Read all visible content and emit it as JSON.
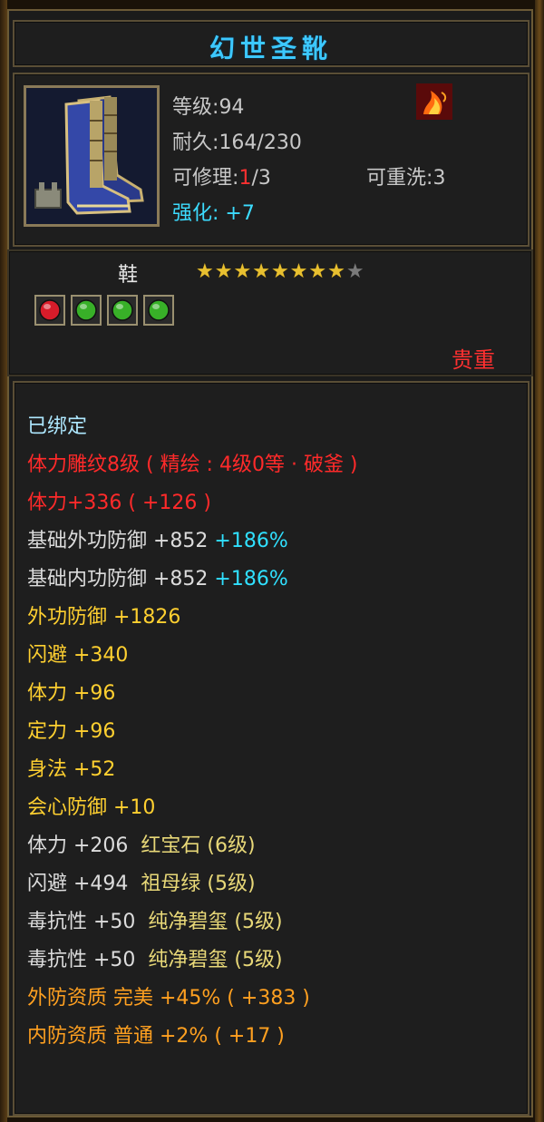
{
  "title": "幻世圣靴",
  "info": {
    "level_label": "等级",
    "level_value": "94",
    "durability_label": "耐久",
    "durability_value": "164/230",
    "repair_label": "可修理",
    "repair_used": "1",
    "repair_total": "/3",
    "rewash_label": "可重洗",
    "rewash_value": "3",
    "enhance_label": "强化:",
    "enhance_value": "+7"
  },
  "item_type": "鞋",
  "stars": {
    "filled": 8,
    "total": 9
  },
  "sockets": [
    {
      "color": "#d81c2a",
      "icon": "red-gem-icon"
    },
    {
      "color": "#38b028",
      "icon": "green-gem-icon"
    },
    {
      "color": "#38b028",
      "icon": "green-gem-icon"
    },
    {
      "color": "#38b028",
      "icon": "green-gem-icon"
    }
  ],
  "rarity": "贵重",
  "stats": {
    "bound": "已绑定",
    "engrave": "体力雕纹8级 ( 精绘 : 4级0等 · 破釜 )",
    "vit_main": "体力+336 ( +126 )",
    "base_ext_def": "基础外功防御  +852",
    "base_ext_def_pct": "+186%",
    "base_int_def": "基础内功防御  +852",
    "base_int_def_pct": "+186%",
    "ext_def": "外功防御  +1826",
    "dodge": "闪避  +340",
    "vit": "体力  +96",
    "focus": "定力  +96",
    "agility": "身法  +52",
    "crit_def": "会心防御  +10",
    "gem1_stat": "体力  +206",
    "gem1_name": "红宝石 (6级)",
    "gem2_stat": "闪避  +494",
    "gem2_name": "祖母绿 (5级)",
    "gem3_stat": "毒抗性  +50",
    "gem3_name": "纯净碧玺 (5级)",
    "gem4_stat": "毒抗性  +50",
    "gem4_name": "纯净碧玺 (5级)",
    "ext_quality": "外防资质   完美  +45% ( +383 )",
    "int_quality": "内防资质   普通  +2% ( +17 )"
  }
}
